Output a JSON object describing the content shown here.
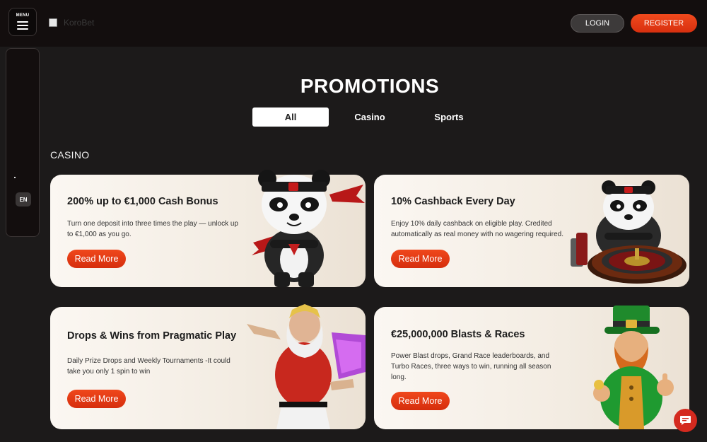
{
  "header": {
    "menu_label": "MENU",
    "logo_text": "KoroBet",
    "login_label": "LOGIN",
    "register_label": "REGISTER"
  },
  "sidebar": {
    "language": "EN"
  },
  "main": {
    "title": "PROMOTIONS",
    "tabs": [
      {
        "label": "All",
        "active": true
      },
      {
        "label": "Casino",
        "active": false
      },
      {
        "label": "Sports",
        "active": false
      }
    ],
    "section_label": "CASINO",
    "cards": [
      {
        "title": "200% up to €1,000 Cash Bonus",
        "description": "Turn one deposit into three times the play — unlock up to €1,000 as you go.",
        "button": "Read More",
        "art": "panda-ninja-icon"
      },
      {
        "title": "10% Cashback Every Day",
        "description": "Enjoy 10% daily cashback on eligible play. Credited automatically as real money with no wagering required.",
        "button": "Read More",
        "art": "panda-roulette-icon"
      },
      {
        "title": "Drops & Wins from Pragmatic Play",
        "description": "Daily Prize Drops and Weekly Tournaments -It could take you only 1 spin to win",
        "button": "Read More",
        "art": "zeus-character-icon"
      },
      {
        "title": "€25,000,000 Blasts & Races",
        "description": "Power Blast drops, Grand Race leaderboards, and Turbo Races, three ways to win, running all season long.",
        "button": "Read More",
        "art": "leprechaun-character-icon"
      }
    ]
  },
  "colors": {
    "accent": "#e63c16",
    "background": "#1c1a1a",
    "topbar": "#130e0e",
    "card": "#f6f0e8"
  }
}
